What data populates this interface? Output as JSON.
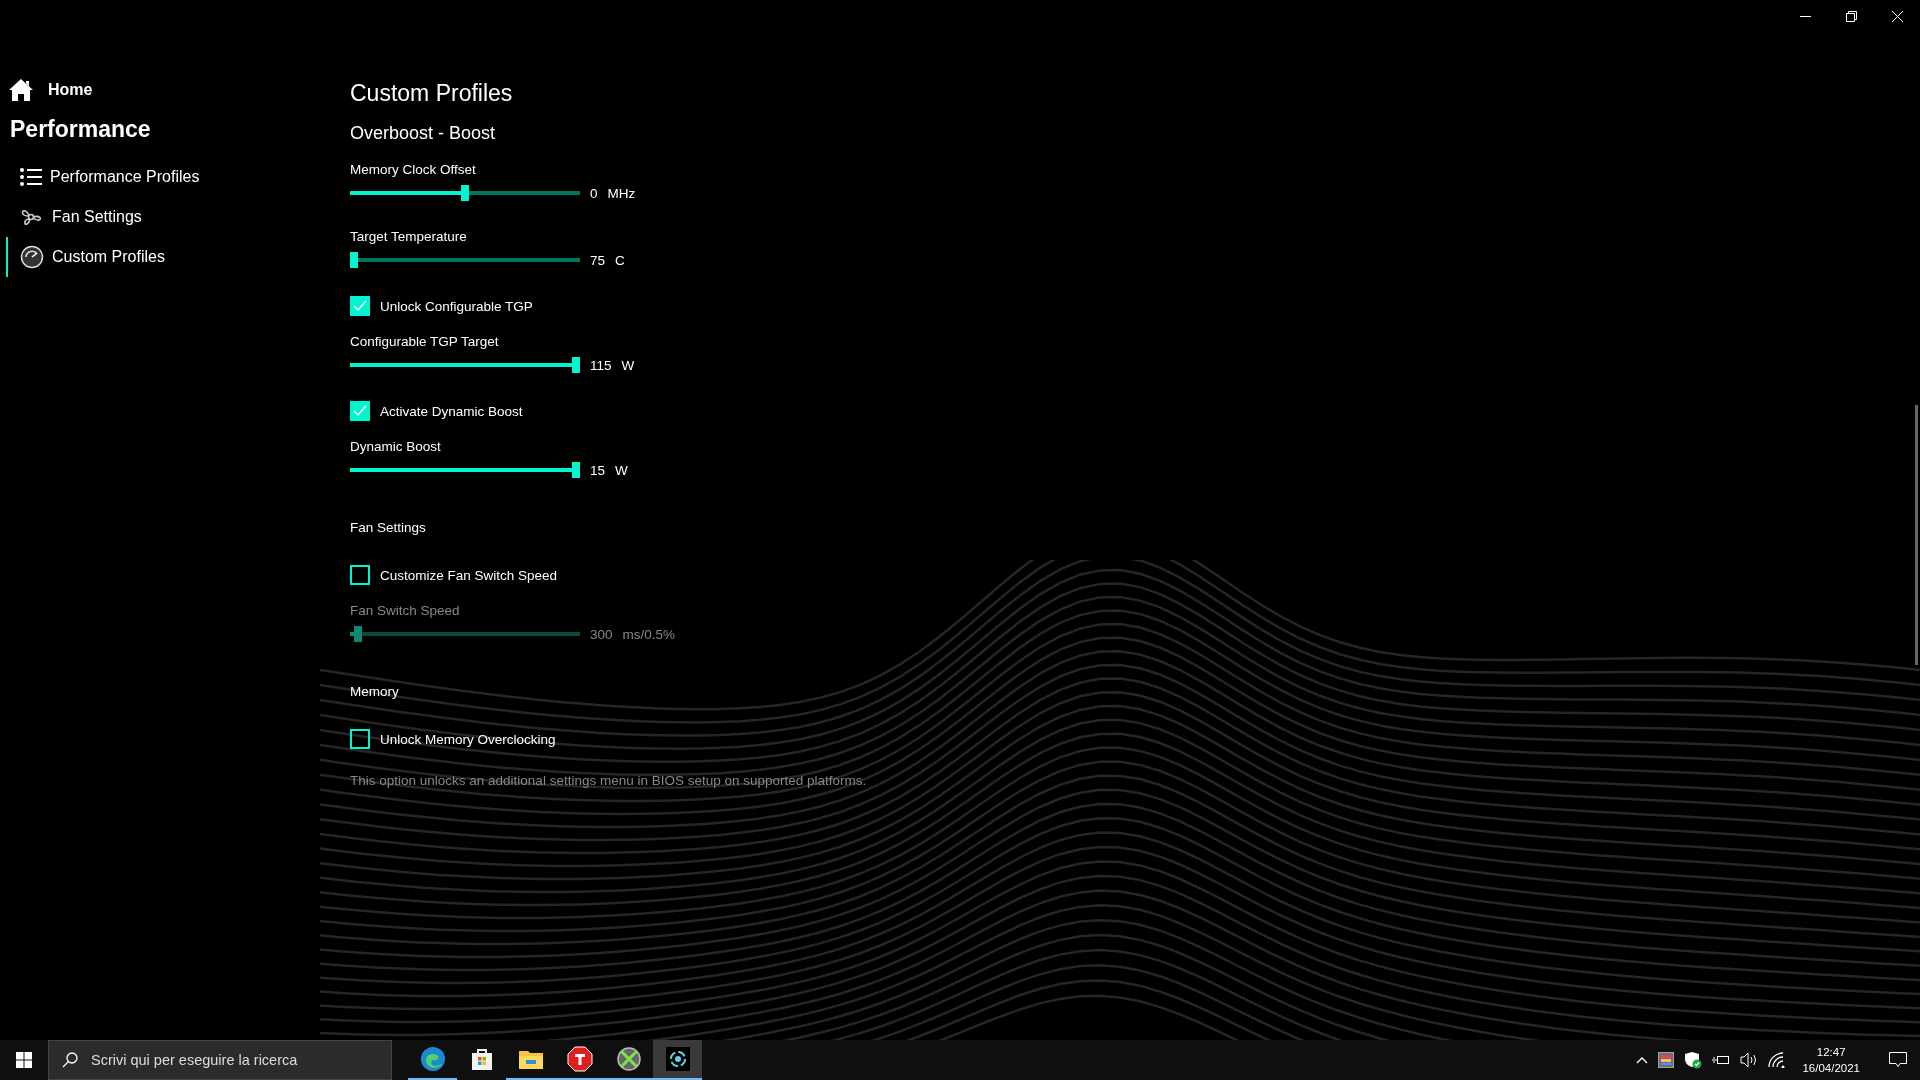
{
  "sidebar": {
    "home": {
      "label": "Home"
    },
    "section_title": "Performance",
    "items": [
      {
        "label": "Performance Profiles",
        "selected": false
      },
      {
        "label": "Fan Settings",
        "selected": false
      },
      {
        "label": "Custom Profiles",
        "selected": true
      }
    ]
  },
  "page": {
    "title": "Custom Profiles",
    "subtitle": "Overboost - Boost",
    "settings": [
      {
        "kind": "slider",
        "label": "Memory Clock Offset",
        "level": 0.5,
        "value": "0",
        "unit": "MHz",
        "disabled": false
      },
      {
        "kind": "slider",
        "label": "Target Temperature",
        "level": 0,
        "value": "75",
        "unit": "C",
        "disabled": false
      },
      {
        "kind": "checkbox",
        "label": "Unlock Configurable TGP",
        "checked": true
      },
      {
        "kind": "slider",
        "label": "Configurable TGP Target",
        "level": 1,
        "value": "115",
        "unit": "W",
        "disabled": false
      },
      {
        "kind": "checkbox",
        "label": "Activate Dynamic Boost",
        "checked": true
      },
      {
        "kind": "slider",
        "label": "Dynamic Boost",
        "level": 1,
        "value": "15",
        "unit": "W",
        "disabled": false
      },
      {
        "kind": "section",
        "label": "Fan Settings"
      },
      {
        "kind": "checkbox",
        "label": "Customize Fan Switch Speed",
        "checked": false
      },
      {
        "kind": "slider",
        "label": "Fan Switch Speed",
        "level": 0.02,
        "value": "300",
        "unit": "ms/0.5%",
        "disabled": true
      },
      {
        "kind": "section",
        "label": "Memory"
      },
      {
        "kind": "checkbox",
        "label": "Unlock Memory Overclocking",
        "checked": false
      },
      {
        "kind": "note",
        "label": "This option unlocks an additional settings menu in BIOS setup on supported platforms."
      }
    ]
  },
  "taskbar": {
    "search": {
      "placeholder": "Scrivi qui per eseguire la ricerca"
    },
    "apps": [
      {
        "running": true,
        "selected": false
      },
      {
        "running": false,
        "selected": false
      },
      {
        "running": true,
        "selected": false
      },
      {
        "running": true,
        "selected": false
      },
      {
        "running": true,
        "selected": false
      },
      {
        "running": true,
        "selected": true
      }
    ],
    "time": "12:47",
    "date": "16/04/2021"
  }
}
